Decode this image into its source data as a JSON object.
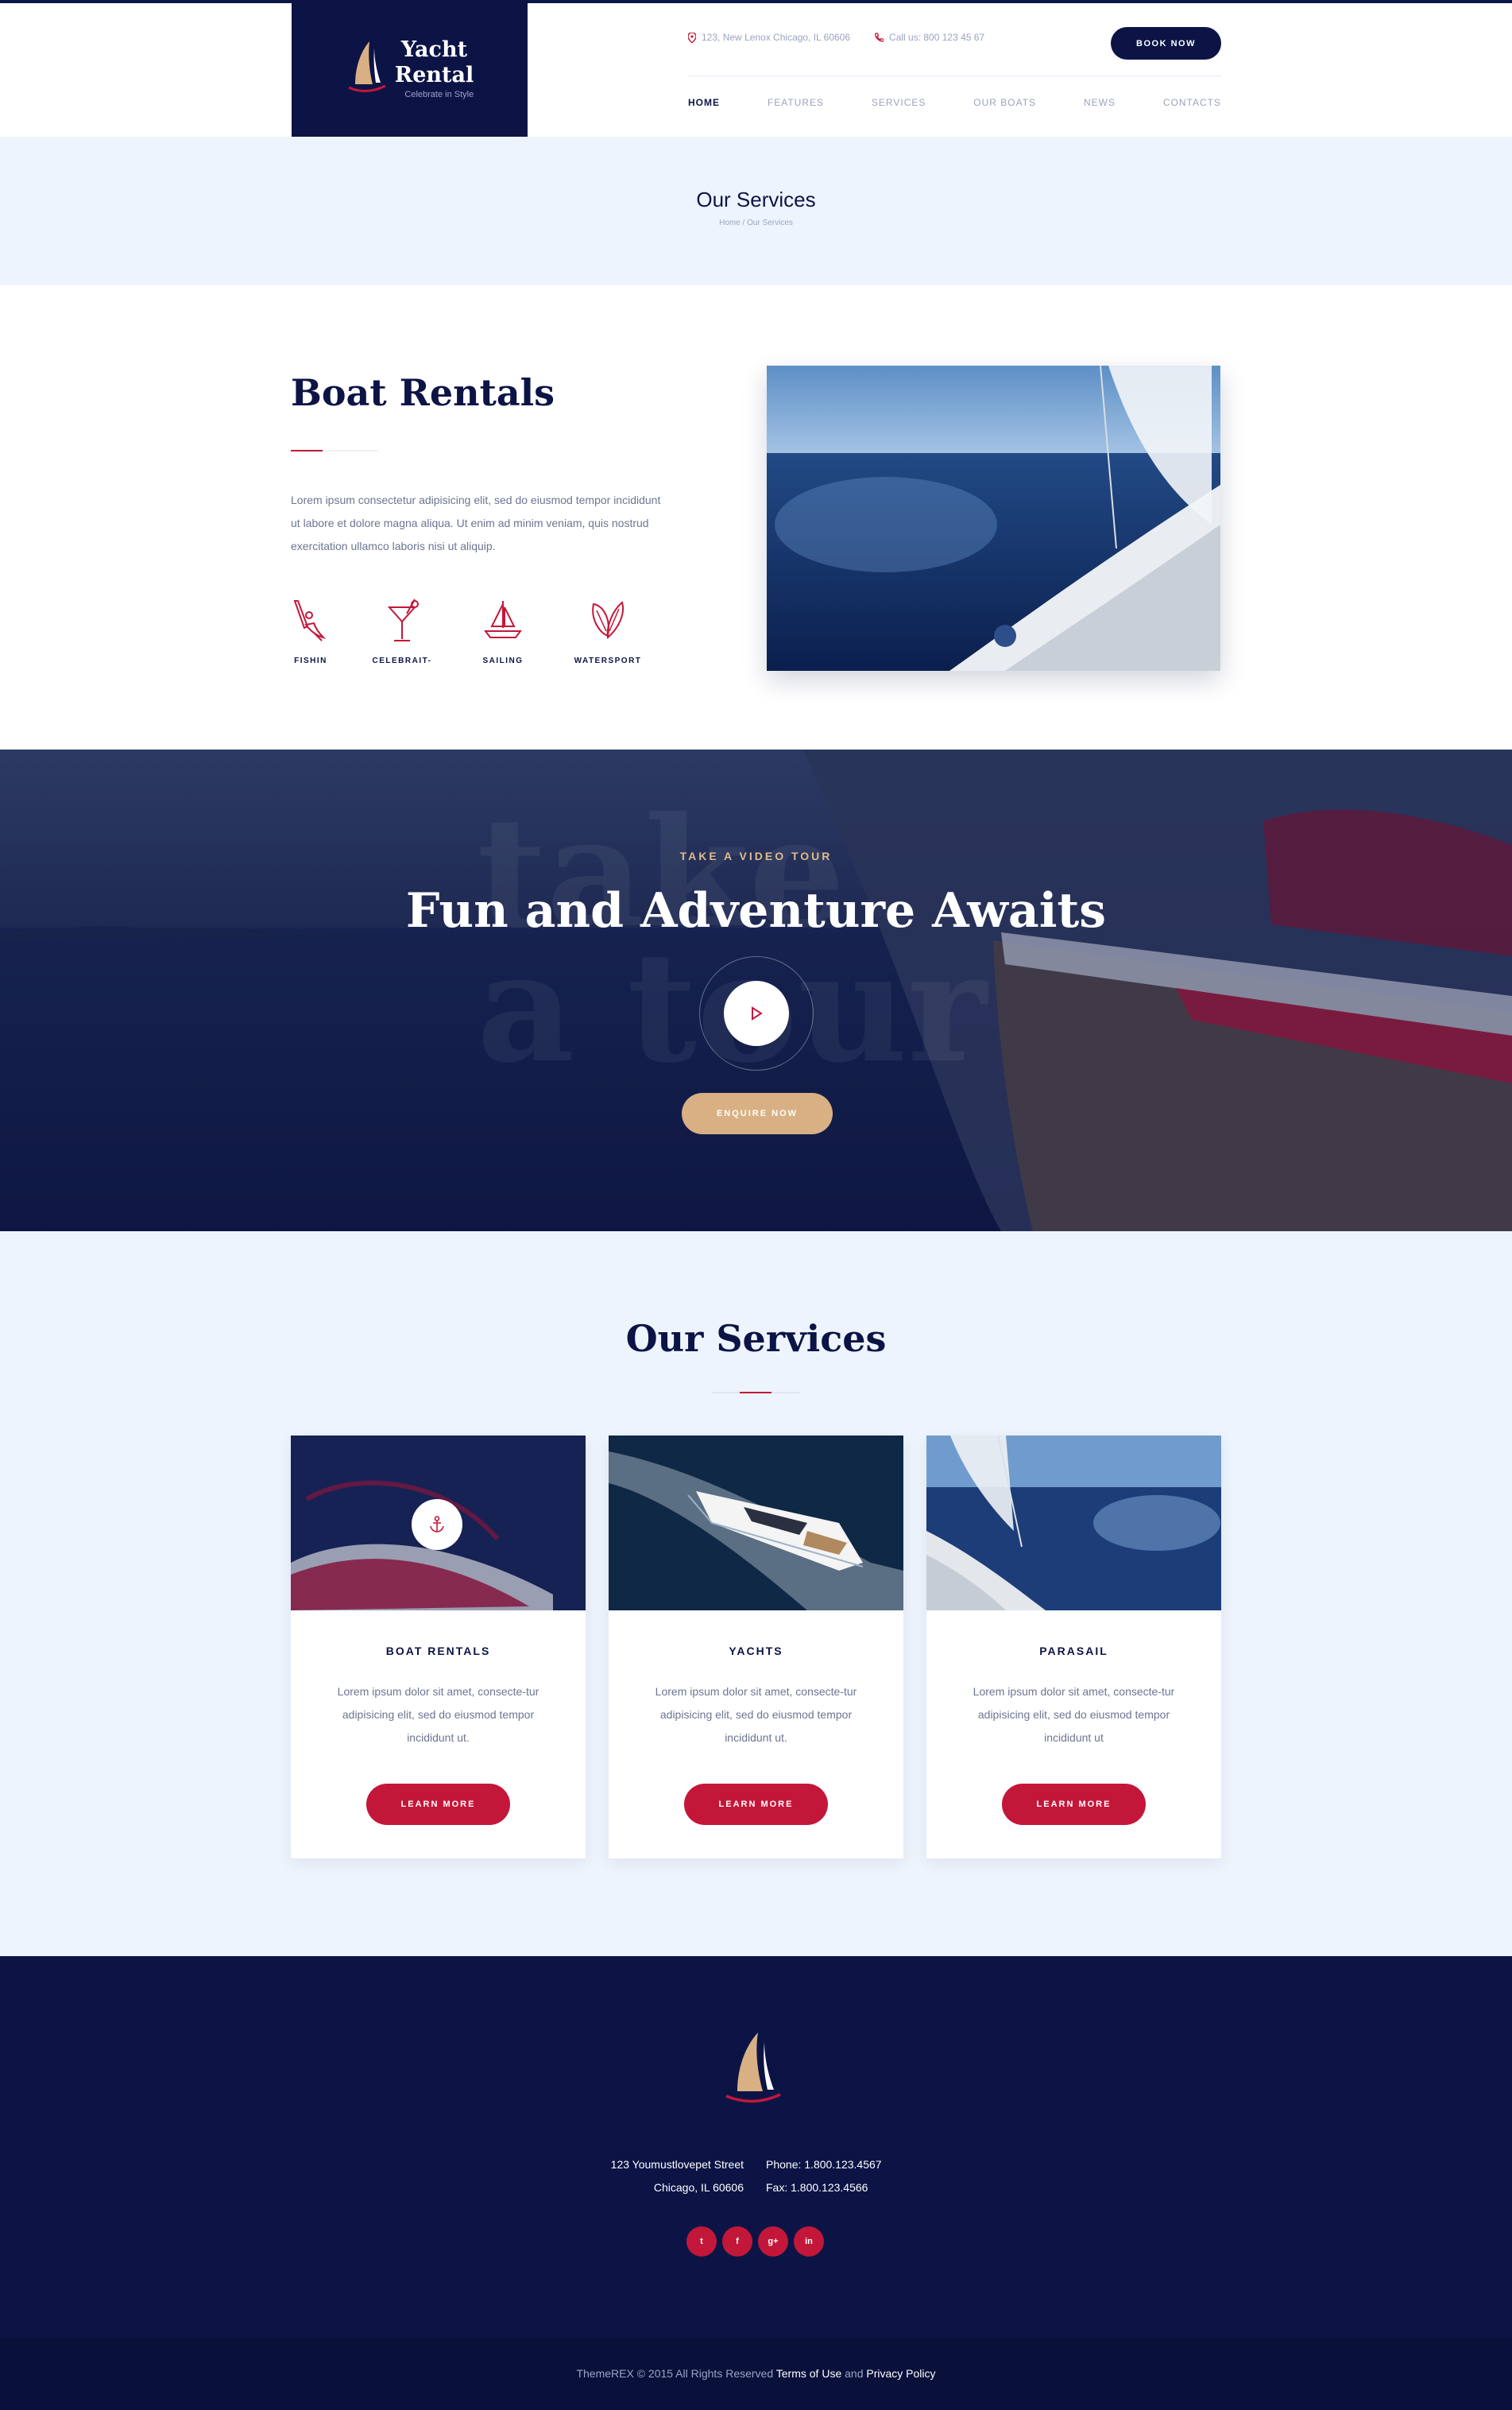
{
  "brand": {
    "name_line1": "Yacht",
    "name_line2": "Rental",
    "tagline": "Celebrate in Style"
  },
  "header": {
    "address": "123, New Lenox Chicago, IL 60606",
    "phone": "Call us: 800 123 45 67",
    "book_label": "BOOK NOW",
    "nav": [
      "HOME",
      "FEATURES",
      "SERVICES",
      "OUR BOATS",
      "NEWS",
      "CONTACTS"
    ],
    "active_nav": "HOME"
  },
  "page_title": {
    "title": "Our Services",
    "breadcrumb": "Home / Our Services"
  },
  "intro": {
    "title": "Boat Rentals",
    "text": "Lorem ipsum consectetur adipisicing elit, sed do eiusmod tempor incididunt ut labore et dolore magna aliqua. Ut enim ad minim veniam, quis nostrud exercitation ullamco laboris nisi ut aliquip.",
    "features": [
      {
        "label": "FISHIN",
        "icon": "fishing-icon"
      },
      {
        "label": "CELEBRAIT-",
        "icon": "cocktail-icon"
      },
      {
        "label": "SAILING",
        "icon": "sailboat-icon"
      },
      {
        "label": "WATERSPORT",
        "icon": "surfboard-icon"
      }
    ]
  },
  "video": {
    "kicker": "TAKE A VIDEO TOUR",
    "title": "Fun and Adventure Awaits",
    "ghost_text_1": "take",
    "ghost_text_2": "a tour",
    "enquire_label": "ENQUIRE NOW"
  },
  "services": {
    "title": "Our Services",
    "cards": [
      {
        "title": "BOAT RENTALS",
        "text": "Lorem ipsum dolor sit amet, consecte-tur adipisicing elit, sed do eiusmod tempor incididunt ut.",
        "button": "LEARN MORE"
      },
      {
        "title": "YACHTS",
        "text": "Lorem ipsum dolor sit amet, consecte-tur adipisicing elit, sed do eiusmod tempor incididunt ut.",
        "button": "LEARN MORE"
      },
      {
        "title": "PARASAIL",
        "text": "Lorem ipsum dolor sit amet, consecte-tur adipisicing elit, sed do eiusmod tempor incididunt ut",
        "button": "LEARN MORE"
      }
    ]
  },
  "footer": {
    "address_line1": "123 Youmustlovepet Street",
    "address_line2": "Chicago, IL 60606",
    "phone": "Phone: 1.800.123.4567",
    "fax": "Fax: 1.800.123.4566",
    "socials": [
      {
        "glyph": "t",
        "name": "twitter-icon"
      },
      {
        "glyph": "f",
        "name": "facebook-icon"
      },
      {
        "glyph": "g+",
        "name": "google-plus-icon"
      },
      {
        "glyph": "in",
        "name": "linkedin-icon"
      }
    ],
    "copyright_prefix": "ThemeREX © 2015 All Rights Reserved",
    "terms": "Terms of Use",
    "and": "and",
    "privacy": "Privacy Policy"
  },
  "colors": {
    "navy": "#0c1446",
    "crimson": "#c3173a",
    "sand": "#d9b083",
    "light_blue": "#edf4fd"
  }
}
